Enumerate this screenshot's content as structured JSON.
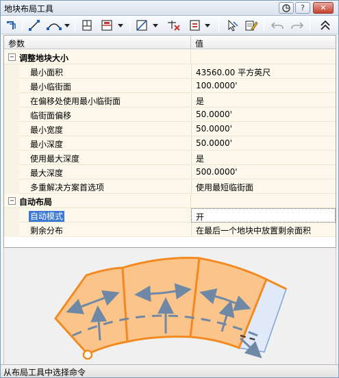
{
  "window": {
    "title": "地块布局工具"
  },
  "titlebar_buttons": [
    {
      "icon": "pin-icon"
    },
    {
      "icon": "help-icon",
      "label": "?"
    },
    {
      "icon": "close-icon",
      "label": "✕"
    }
  ],
  "toolbar": {
    "items": [
      "create-parcel-icon",
      "line-icon",
      "curve-icon",
      "frontage-icon",
      "slide-line-icon",
      "swing-line-icon",
      "delete-subentity-icon",
      "parcel-union-icon",
      "pick-subentity-icon",
      "edit-icon",
      "undo-icon",
      "redo-icon",
      "collapse-icon"
    ]
  },
  "grid": {
    "header": {
      "name": "参数",
      "value": "值"
    },
    "categories": [
      {
        "label": "调整地块大小",
        "expanded": true,
        "rows": [
          {
            "name": "最小面积",
            "value": "43560.00 平方英尺"
          },
          {
            "name": "最小临街面",
            "value": "100.0000'"
          },
          {
            "name": "在偏移处使用最小临街面",
            "value": "是"
          },
          {
            "name": "临街面偏移",
            "value": "50.0000'"
          },
          {
            "name": "最小宽度",
            "value": "50.0000'"
          },
          {
            "name": "最小深度",
            "value": "50.0000'"
          },
          {
            "name": "使用最大深度",
            "value": "是"
          },
          {
            "name": "最大深度",
            "value": "500.0000'"
          },
          {
            "name": "多重解决方案首选项",
            "value": "使用最短临街面"
          }
        ]
      },
      {
        "label": "自动布局",
        "expanded": true,
        "rows": [
          {
            "name": "自动模式",
            "value": "开",
            "selected": true
          },
          {
            "name": "剩余分布",
            "value": "在最后一个地块中放置剩余面积"
          }
        ]
      }
    ]
  },
  "colors": {
    "parcel_fill": "#fbc48a",
    "parcel_border": "#f28a1f",
    "remainder_fill": "#dfe9f7",
    "arrow": "#6f88a6",
    "selection": "#3b79d4"
  },
  "status": {
    "text": "从布局工具中选择命令"
  }
}
